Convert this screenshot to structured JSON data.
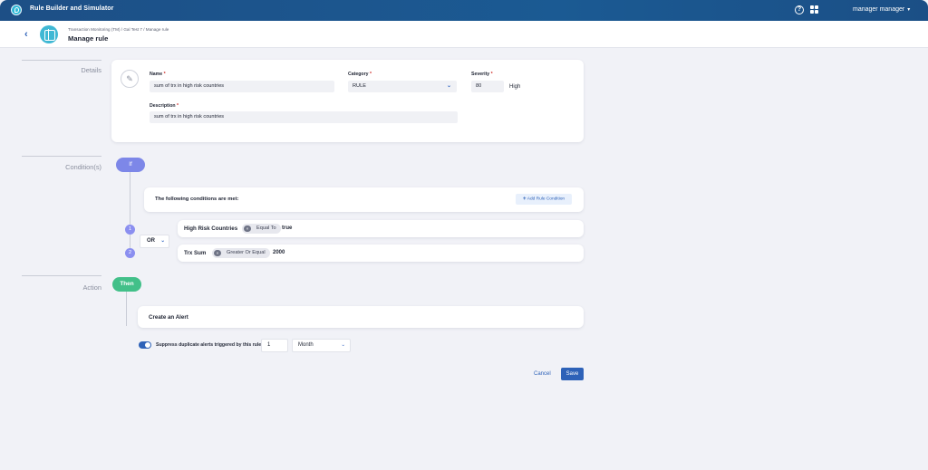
{
  "app": {
    "title": "Rule Builder and Simulator",
    "user": "manager manager",
    "help_glyph": "?"
  },
  "header": {
    "breadcrumb": "Transaction Monitoring (TM) / Gal Test 7 / Manage rule",
    "title": "Manage rule"
  },
  "sections": {
    "details": "Details",
    "conditions": "Condition(s)",
    "action": "Action"
  },
  "details": {
    "name_label": "Name",
    "name_value": "sum of trx in high risk countries",
    "category_label": "Category",
    "category_value": "RULE",
    "severity_label": "Severity",
    "severity_value": "80",
    "severity_text": "High",
    "description_label": "Description",
    "description_value": "sum of trx in high risk countries",
    "required_mark": "*"
  },
  "conditions": {
    "if_label": "If",
    "header": "The following conditions are met:",
    "add_button": "Add Rule Condition",
    "operator": "OR",
    "rows": [
      {
        "index": "1",
        "field": "High Risk Countries",
        "comparator": "Equal To",
        "value": "true"
      },
      {
        "index": "2",
        "field": "Trx Sum",
        "comparator": "Greater Or Equal",
        "value": "2000"
      }
    ]
  },
  "action": {
    "then_label": "Then",
    "action_text": "Create an Alert",
    "suppress_label": "Suppress duplicate alerts triggered by this rule",
    "suppress_enabled": true,
    "period_value": "1",
    "period_unit": "Month"
  },
  "footer": {
    "cancel": "Cancel",
    "save": "Save"
  },
  "colors": {
    "topbar": "#1d4f86",
    "primary": "#2e62b8",
    "if_pill": "#7d87e8",
    "then_pill": "#42c089",
    "required": "#d0312d"
  }
}
